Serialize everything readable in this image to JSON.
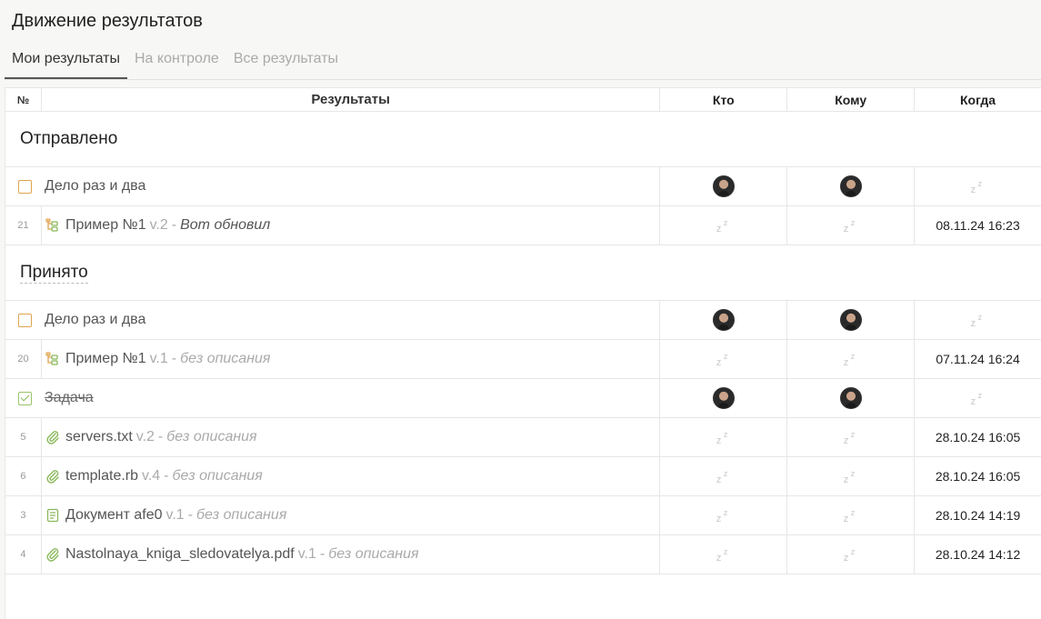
{
  "page_title": "Движение результатов",
  "tabs": [
    {
      "label": "Мои результаты",
      "active": true
    },
    {
      "label": "На контроле",
      "active": false
    },
    {
      "label": "Все результаты",
      "active": false
    }
  ],
  "header": {
    "num": "№",
    "results": "Результаты",
    "who": "Кто",
    "to": "Кому",
    "when": "Когда"
  },
  "groups": [
    {
      "title": "Отправлено",
      "task": {
        "title": "Дело раз и два",
        "done": false
      },
      "items": [
        {
          "num": "21",
          "icon": "tree-icon",
          "name": "Пример №1",
          "ver": "v.2",
          "desc": "Вот обновил",
          "when": "08.11.24 16:23"
        }
      ]
    },
    {
      "title": "Принято",
      "task": {
        "title": "Дело раз и два",
        "done": false
      },
      "items": [
        {
          "num": "20",
          "icon": "tree-icon",
          "name": "Пример №1",
          "ver": "v.1",
          "desc": "без описания",
          "when": "07.11.24 16:24"
        }
      ],
      "task2": {
        "title": "Задача",
        "done": true
      },
      "items2": [
        {
          "num": "5",
          "icon": "paperclip-icon",
          "name": "servers.txt",
          "ver": "v.2",
          "desc": "без описания",
          "when": "28.10.24 16:05"
        },
        {
          "num": "6",
          "icon": "paperclip-icon",
          "name": "template.rb",
          "ver": "v.4",
          "desc": "без описания",
          "when": "28.10.24 16:05"
        },
        {
          "num": "3",
          "icon": "document-icon",
          "name": "Документ afe0",
          "ver": "v.1",
          "desc": "без описания",
          "when": "28.10.24 14:19"
        },
        {
          "num": "4",
          "icon": "paperclip-icon",
          "name": "Nastolnaya_kniga_sledovatelya.pdf",
          "ver": "v.1",
          "desc": "без описания",
          "when": "28.10.24 14:12"
        }
      ]
    }
  ],
  "separator": "-",
  "snooze_icon": "zz-icon",
  "colors": {
    "task_checkbox": "#e0a54f",
    "done_checkbox": "#8ab85a",
    "icon_green": "#8ab85a",
    "tree_icon_orange": "#e0a54f"
  }
}
